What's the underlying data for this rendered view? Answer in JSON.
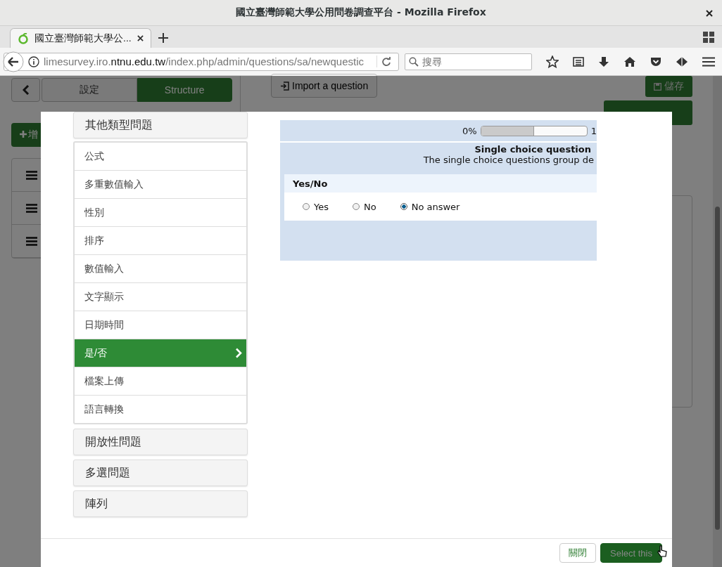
{
  "window": {
    "title": "國立臺灣師範大學公用問卷調查平台 - Mozilla Firefox"
  },
  "tabs": [
    {
      "title": "國立臺灣師範大學公...",
      "selected": true
    }
  ],
  "address_bar": {
    "url": "limesurvey.iro.**ntnu.edu.tw**/index.php/admin/questions/sa/newquestic"
  },
  "search": {
    "placeholder": "搜尋"
  },
  "sidebar": {
    "tabs": [
      {
        "label": "設定",
        "selected": false
      },
      {
        "label": "Structure",
        "selected": true
      }
    ],
    "add_button": "增",
    "rows": [
      {
        "kind": "handle"
      },
      {
        "kind": "handle"
      },
      {
        "kind": "handle"
      }
    ]
  },
  "toolbar": {
    "import_button": "Import a question",
    "save_button": "儲存"
  },
  "modal": {
    "categories": [
      {
        "label": "其他類型問題",
        "items": [
          {
            "label": "公式",
            "selected": false
          },
          {
            "label": "多重數值輸入",
            "selected": false
          },
          {
            "label": "性別",
            "selected": false
          },
          {
            "label": "排序",
            "selected": false
          },
          {
            "label": "數值輸入",
            "selected": false
          },
          {
            "label": "文字顯示",
            "selected": false
          },
          {
            "label": "日期時間",
            "selected": false
          },
          {
            "label": "是/否",
            "selected": true
          },
          {
            "label": "檔案上傳",
            "selected": false
          },
          {
            "label": "語言轉換",
            "selected": false
          }
        ]
      },
      {
        "label": "開放性問題"
      },
      {
        "label": "多選問題"
      },
      {
        "label": "陣列"
      }
    ],
    "preview": {
      "progress": {
        "start": "0%",
        "end": "1",
        "level": 0.5
      },
      "group_title": "Single choice question",
      "group_description": "The single choice questions group de",
      "question": "Yes/No",
      "options": [
        {
          "label": "Yes",
          "selected": false
        },
        {
          "label": "No",
          "selected": false
        },
        {
          "label": "No answer",
          "selected": true
        }
      ]
    },
    "buttons": [
      {
        "label": "關閉",
        "kind": "default"
      },
      {
        "label": "Select this",
        "kind": "primary"
      }
    ]
  }
}
